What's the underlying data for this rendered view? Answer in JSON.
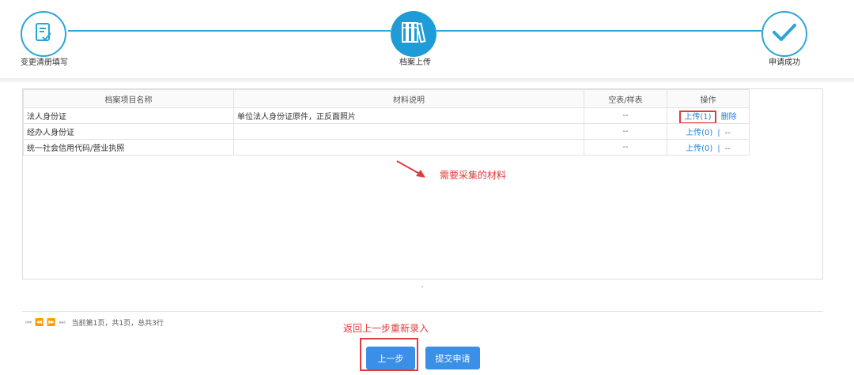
{
  "steps": [
    {
      "label": "变更清册填写",
      "icon": "form-check-icon",
      "state": "done"
    },
    {
      "label": "档案上传",
      "icon": "archive-binders-icon",
      "state": "active"
    },
    {
      "label": "申请成功",
      "icon": "checkmark-icon",
      "state": "pending"
    }
  ],
  "colors": {
    "step_accent": "#2aa5d6",
    "step_active": "#1e9cd7",
    "button_primary": "#3b8fe6",
    "annotation_red": "#e03b3b",
    "link_blue": "#2a7fd6"
  },
  "table": {
    "headers": [
      "档案项目名称",
      "材料说明",
      "空表/样表",
      "操作"
    ],
    "rows": [
      {
        "name": "法人身份证",
        "desc": "单位法人身份证原件，正反面照片",
        "template": "--",
        "upload": "上传(1)",
        "sep": "|",
        "action2": "删除"
      },
      {
        "name": "经办人身份证",
        "desc": "",
        "template": "--",
        "upload": "上传(0)",
        "sep": "|",
        "action2": "--"
      },
      {
        "name": "统一社会信用代码/营业执照",
        "desc": "",
        "template": "--",
        "upload": "上传(0)",
        "sep": "|",
        "action2": "--"
      }
    ]
  },
  "annotations": {
    "materials": "需要采集的材料",
    "go_back": "返回上一步重新录入"
  },
  "pager": {
    "status": "当前第1页，共1页，总共3行"
  },
  "buttons": {
    "prev": "上一步",
    "submit": "提交申请"
  }
}
